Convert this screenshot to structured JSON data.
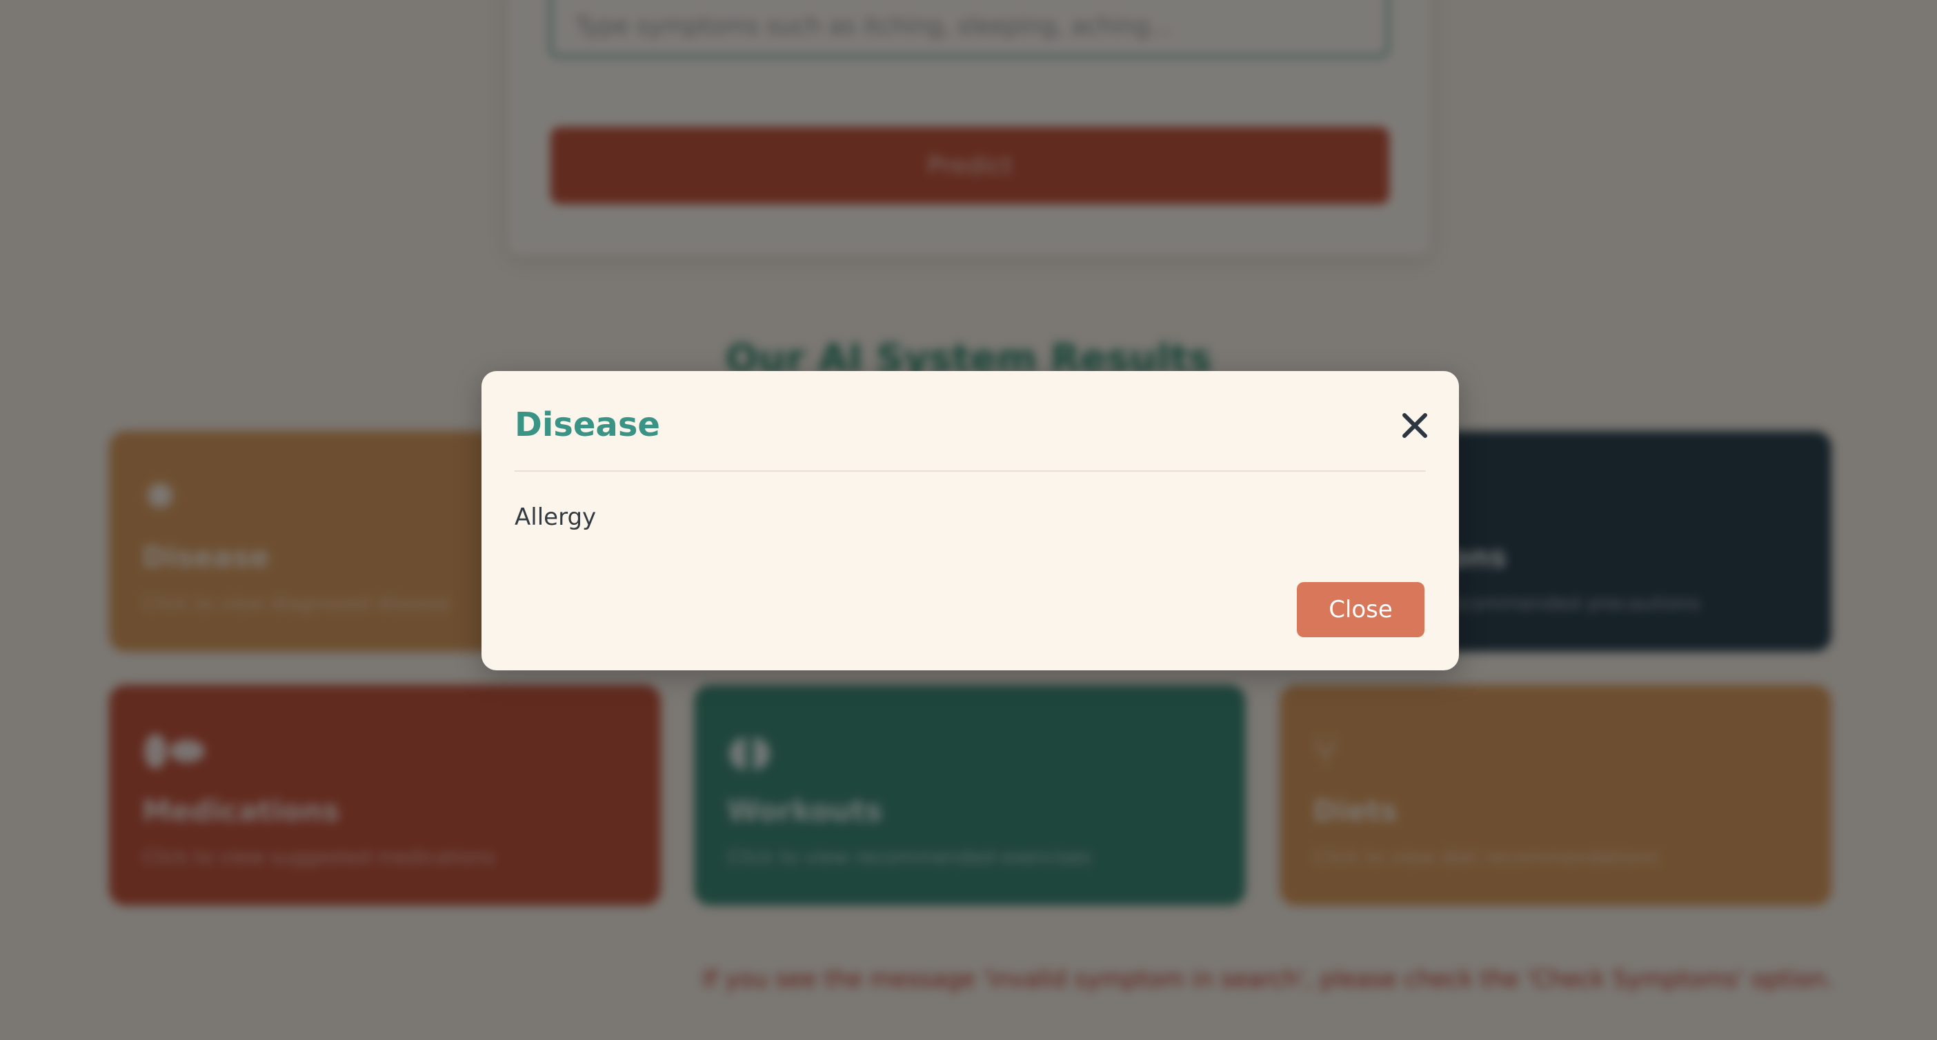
{
  "form": {
    "symptom_placeholder": "Type symptoms such as itching, sleeping, aching...",
    "predict_label": "Predict"
  },
  "results_section": {
    "title": "Our AI System Results"
  },
  "cards": {
    "disease": {
      "icon": "virus-icon",
      "glyph": "✹",
      "title": "Disease",
      "subtitle": "Click to view diagnosed disease"
    },
    "precautions": {
      "icon": "shield-icon",
      "glyph": "⛨",
      "title": "Precautions",
      "subtitle": "Click to view recommended precautions"
    },
    "medications": {
      "icon": "pills-icon",
      "glyph": "⬮⬬",
      "title": "Medications",
      "subtitle": "Click to view suggested medications"
    },
    "workouts": {
      "icon": "dumbbell-icon",
      "glyph": "◖◗",
      "title": "Workouts",
      "subtitle": "Click to view recommended exercises"
    },
    "diets": {
      "icon": "utensils-icon",
      "glyph": "⑂",
      "title": "Diets",
      "subtitle": "Click to view diet recommendations"
    }
  },
  "footer": {
    "note": "If you see the message 'invalid symptom in search', please check the 'Check Symptoms' option."
  },
  "modal": {
    "title": "Disease",
    "body": "Allergy",
    "close_label": "Close",
    "close_icon": "close-icon"
  },
  "colors": {
    "teal": "#3a9486",
    "coral": "#d9775b",
    "orange": "#dc9d60",
    "navy": "#2c4350",
    "green": "#3f8c79",
    "red": "#c4563f",
    "modal_bg": "#fcf5ec"
  }
}
